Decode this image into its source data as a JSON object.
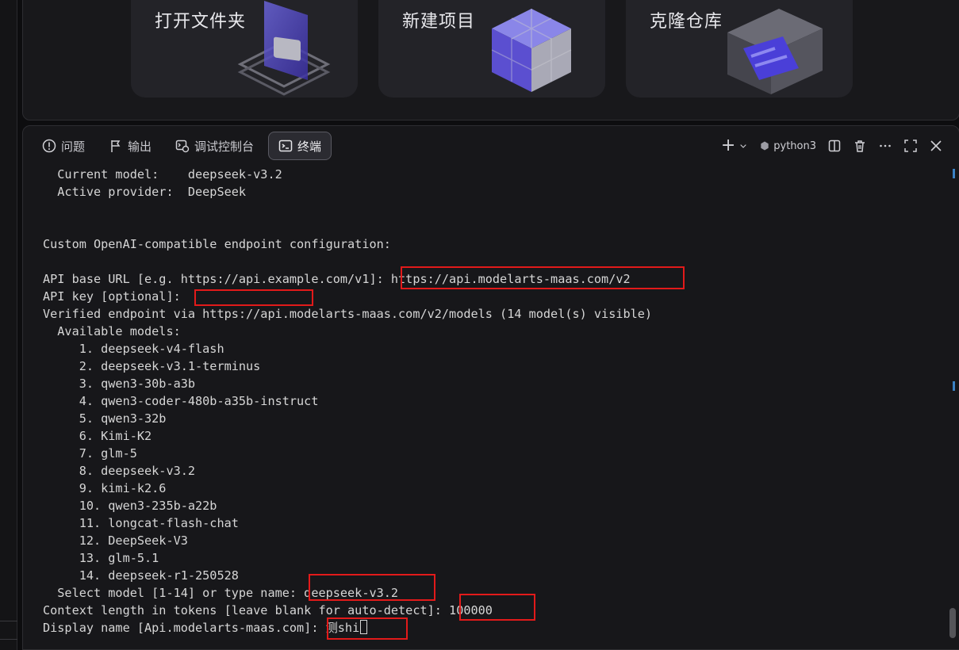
{
  "welcome": {
    "cards": [
      {
        "label": "打开文件夹",
        "icon": "folder-icon"
      },
      {
        "label": "新建项目",
        "icon": "cube-icon"
      },
      {
        "label": "克隆仓库",
        "icon": "repository-icon"
      }
    ]
  },
  "panel": {
    "tabs": [
      {
        "label": "问题",
        "icon": "warning-circle-icon",
        "active": false
      },
      {
        "label": "输出",
        "icon": "flag-icon",
        "active": false
      },
      {
        "label": "调试控制台",
        "icon": "debug-console-icon",
        "active": false
      },
      {
        "label": "终端",
        "icon": "terminal-icon",
        "active": true
      }
    ],
    "toolbar": {
      "add_label": "+",
      "kernel_label": "python3"
    }
  },
  "terminal": {
    "lines": [
      "  Current model:    deepseek-v3.2",
      "  Active provider:  DeepSeek",
      "",
      "",
      "Custom OpenAI-compatible endpoint configuration:",
      "",
      "API base URL [e.g. https://api.example.com/v1]: https://api.modelarts-maas.com/v2",
      "API key [optional]: ",
      "Verified endpoint via https://api.modelarts-maas.com/v2/models (14 model(s) visible)",
      "  Available models:",
      "     1. deepseek-v4-flash",
      "     2. deepseek-v3.1-terminus",
      "     3. qwen3-30b-a3b",
      "     4. qwen3-coder-480b-a35b-instruct",
      "     5. qwen3-32b",
      "     6. Kimi-K2",
      "     7. glm-5",
      "     8. deepseek-v3.2",
      "     9. kimi-k2.6",
      "     10. qwen3-235b-a22b",
      "     11. longcat-flash-chat",
      "     12. DeepSeek-V3",
      "     13. glm-5.1",
      "     14. deepseek-r1-250528",
      "  Select model [1-14] or type name: deepseek-v3.2",
      "Context length in tokens [leave blank for auto-detect]: 100000",
      "Display name [Api.modelarts-maas.com]: 测shi"
    ]
  },
  "colors": {
    "highlight": "#e21a1a",
    "accent": "#3b82c4"
  }
}
